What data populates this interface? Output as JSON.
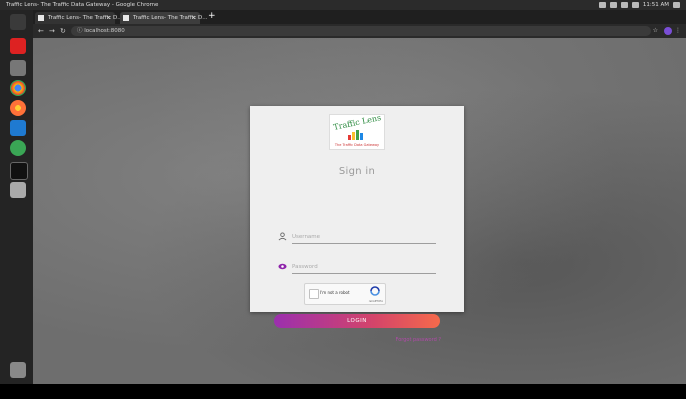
{
  "system": {
    "window_title": "Traffic Lens- The Traffic Data Gateway - Google Chrome",
    "clock": "11:51 AM"
  },
  "browser": {
    "tabs": [
      {
        "label": "Traffic Lens- The Traffic D..."
      },
      {
        "label": "Traffic Lens- The Traffic D..."
      }
    ],
    "new_tab": "+",
    "close": "×",
    "url": "localhost:8080"
  },
  "login": {
    "logo_text": "Traffic Lens",
    "logo_tagline": "The Traffic Data Gateway",
    "heading": "Sign in",
    "username_placeholder": "Username",
    "password_placeholder": "Password",
    "captcha_label": "I'm not a robot",
    "captcha_brand": "reCAPTCHA",
    "login_button": "LOGIN",
    "forgot_link": "Forgot password ?"
  },
  "colors": {
    "button_start": "#9b2fae",
    "button_end": "#f56a4b",
    "link": "#b04aa8"
  }
}
